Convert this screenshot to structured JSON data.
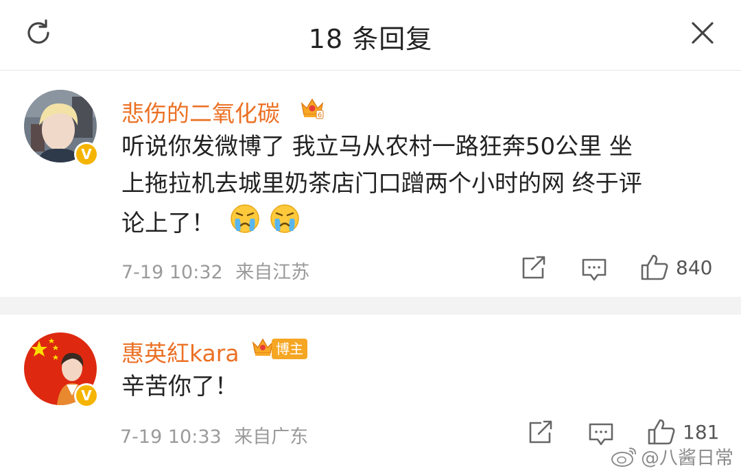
{
  "header": {
    "title": "18 条回复",
    "refresh_icon": "refresh-icon",
    "close_icon": "close-icon"
  },
  "comments": [
    {
      "username": "悲伤的二氧化碳",
      "badge_icon": "vip-crown-icon",
      "badge_level": "6",
      "text_line1": "听说你发微博了 我立马从农村一路狂奔50公里 坐",
      "text_line2": "上拖拉机去城里奶茶店门口蹭两个小时的网 终于评",
      "text_line3": "论上了！",
      "emoji": "crying-emoji",
      "date": "7-19 10:32",
      "location": "来自江苏",
      "likes": "840"
    },
    {
      "username": "惠英紅kara",
      "badge_icon": "vip-crown-icon",
      "badge_label": "博主",
      "text": "辛苦你了！",
      "date": "7-19 10:33",
      "location": "来自广东",
      "likes": "181"
    }
  ],
  "watermark": {
    "text": "@八酱日常",
    "icon": "weibo-logo-icon"
  },
  "colors": {
    "username": "#eb7024",
    "verify_badge": "#f5b400",
    "meta": "#9a9a9a",
    "separator": "#f3f3f3"
  }
}
